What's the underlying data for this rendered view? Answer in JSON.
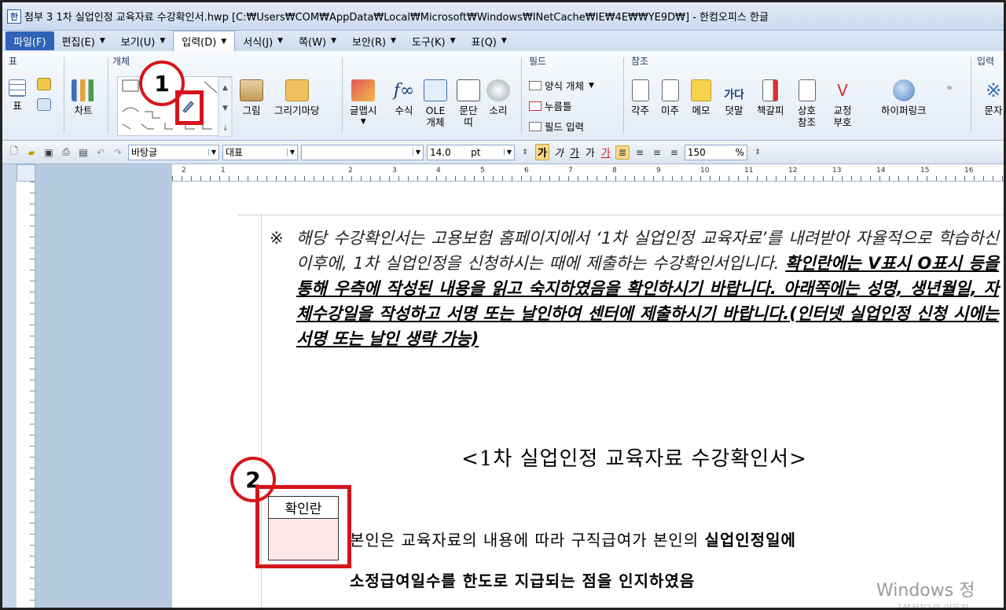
{
  "window": {
    "title": "첨부 3 1차 실업인정 교육자료 수강확인서.hwp [C:₩Users₩COM₩AppData₩Local₩Microsoft₩Windows₩INetCache₩IE₩4E₩₩YE9D₩] - 한컴오피스 한글"
  },
  "menu": {
    "items": [
      "파일(F)",
      "편집(E)",
      "보기(U)",
      "입력(D)",
      "서식(J)",
      "쪽(W)",
      "보안(R)",
      "도구(K)",
      "표(Q)"
    ]
  },
  "ribbon": {
    "groups": {
      "table": "표",
      "object": "개체",
      "field": "필드",
      "reference": "참조",
      "input": "입력"
    },
    "buttons": {
      "table": "표",
      "chart": "차트",
      "picture": "그림",
      "drawing_market": "그리기마당",
      "glyph": "글맵시",
      "formula": "수식",
      "ole_1": "OLE",
      "ole_2": "개체",
      "paragraph_1": "문단",
      "paragraph_2": "띠",
      "sound": "소리",
      "footnote": "각주",
      "endnote": "미주",
      "memo": "메모",
      "annotation": "덧말",
      "bookmark": "책갈피",
      "cross_ref_1": "상호",
      "cross_ref_2": "참조",
      "proof_1": "교정",
      "proof_2": "부호",
      "hyperlink": "하이퍼링크",
      "char": "문자"
    },
    "field_items": [
      "양식 개체",
      "누름틀",
      "필드 입력"
    ]
  },
  "toolbar": {
    "style": "바탕글",
    "font_type": "대표",
    "font_name": "",
    "font_size": "14.0",
    "font_unit": "pt",
    "line_spacing": "150",
    "line_unit": "%",
    "bold": "가",
    "italic": "가",
    "underline": "가",
    "strike": "가",
    "color": "가"
  },
  "ruler": {
    "numbers": [
      "2",
      "1",
      "",
      "1",
      "2",
      "3",
      "4",
      "5",
      "6",
      "7",
      "8",
      "9",
      "10",
      "11",
      "12",
      "13",
      "14",
      "15",
      "16"
    ]
  },
  "document": {
    "note_mark": "※",
    "note_plain": "해당 수강확인서는 고용보험 홈페이지에서 ‘1차 실업인정 교육자료’를 내려받아 자율적으로 학습하신 이후에, 1차 실업인정을 신청하시는 때에 제출하는 수강확인서입니다. ",
    "note_bold": "확인란에는 V표시 O표시 등을 통해 우측에 작성된 내용을 읽고 숙지하였음을 확인하시기 바랍니다. 아래쪽에는 성명, 생년월일, 자체수강일을 작성하고 서명 또는 날인하여 센터에 제출하시기 바랍니다.(인터넷 실업인정 신청 시에는 서명 또는 날인 생략 가능)",
    "title": "<1차 실업인정 교육자료 수강확인서>",
    "confirm_label": "확인란",
    "para1_plain": "본인은 교육자료의 내용에 따라 구직급여가 본인의 ",
    "para1_bold": "실업인정일에",
    "para2": "소정급여일수를 한도로 지급되는 점을 인지하였음"
  },
  "annotations": {
    "callout_1": "1",
    "callout_2": "2",
    "color": "#d8141b"
  },
  "watermark": {
    "main": "Windows 정",
    "sub": "[설정]으로 이동하"
  }
}
